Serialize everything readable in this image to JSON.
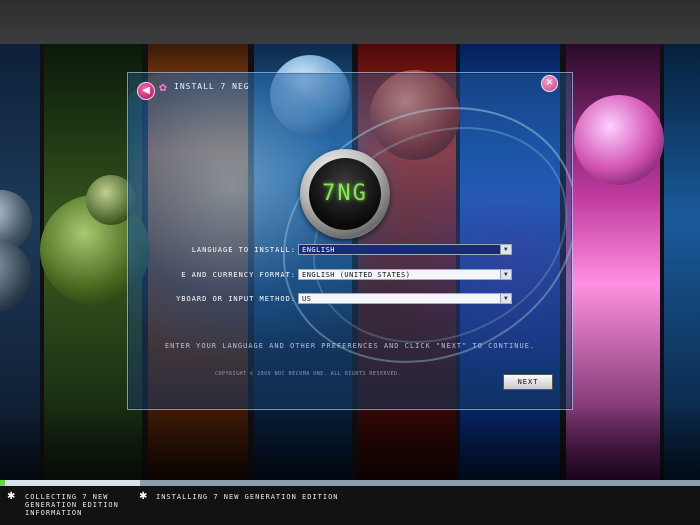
{
  "dialog": {
    "title": "INSTALL 7 NEG",
    "back_icon": "arrow-left-icon",
    "app_icon": "flower-icon",
    "close_icon": "close-icon",
    "logo_text": "7NG",
    "language_label": "LANGUAGE TO INSTALL:",
    "language_value": "ENGLISH",
    "format_label": "E AND CURRENCY FORMAT:",
    "format_value": "ENGLISH (UNITED STATES)",
    "keyboard_label": "YBOARD OR INPUT METHOD:",
    "keyboard_value": "US",
    "hint_text": "ENTER YOUR LANGUAGE AND OTHER PREFERENCES AND CLICK \"NEXT\" TO CONTINUE.",
    "copyright": "COPYRIGHT © 2009 NOC RECOMA ONE. ALL RIGHTS RESERVED.",
    "next_label": "NEXT"
  },
  "taskbar": {
    "progress_fraction": 0.2,
    "steps": [
      {
        "label": "COLLECTING 7 NEW GENERATION EDITION INFORMATION",
        "icon": "asterisk-icon"
      },
      {
        "label": "INSTALLING 7 NEW GENERATION EDITION",
        "icon": "asterisk-icon"
      }
    ]
  },
  "colors": {
    "accent_pink": "#c0407c",
    "logo_green": "#8fe05a",
    "selected_blue": "#1a2a7a"
  }
}
